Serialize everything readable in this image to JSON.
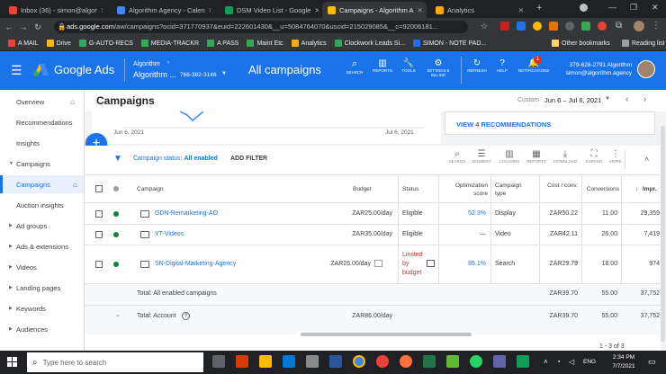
{
  "browser": {
    "tabs": [
      {
        "label": "Inbox (36) - simon@algor",
        "color": "#ea4335"
      },
      {
        "label": "Algorithm Agency - Calen",
        "color": "#4285f4"
      },
      {
        "label": "DSM Video List - Google",
        "color": "#0f9d58"
      },
      {
        "label": "Campaigns - Algorithm A",
        "color": "#fbbc04"
      },
      {
        "label": "Analytics",
        "color": "#f9ab00"
      }
    ],
    "new_tab": "+",
    "url_host": "ads.google.com",
    "url_rest": "/aw/campaigns?ocid=371770937&euid=222601430&__u=5084764070&uscid=215029085&__c=92006181...",
    "bookmarks": [
      "A MAIL",
      "Drive",
      "G-AUTO-RECS",
      "MEDIA-TRACKR",
      "A PASS",
      "Maint Etc",
      "Analytics",
      "Clockwork Leads Si...",
      "SIMON - NOTE PAD..."
    ],
    "other_bookmarks": "Other bookmarks",
    "reading_list": "Reading list"
  },
  "header": {
    "product": "Google Ads",
    "account_name_1": "Algorithm",
    "account_name_2": "Algorithm ...",
    "account_id": "766-382-3146",
    "page": "All campaigns",
    "tools": [
      "SEARCH",
      "REPORTS",
      "TOOLS",
      "SETTINGS & BILLING",
      "REFRESH",
      "HELP",
      "NOTIFICATIONS"
    ],
    "notif_count": "1",
    "user_id": "379-626-2791 Algorithm",
    "user_email": "simon@algorithm.agency"
  },
  "sidebar": {
    "items": [
      "Overview",
      "Recommendations",
      "Insights",
      "Campaigns",
      "Campaigns",
      "Auction insights",
      "Ad groups",
      "Ads & extensions",
      "Videos",
      "Landing pages",
      "Keywords",
      "Audiences"
    ]
  },
  "main": {
    "title": "Campaigns",
    "date_custom": "Custom",
    "date_range": "Jun 6 – Jul 6, 2021",
    "chart_start": "Jun 6, 2021",
    "chart_end": "Jul 6, 2021",
    "recommendations": "VIEW 4 RECOMMENDATIONS",
    "status_filter_label": "Campaign status:",
    "status_filter_value": "All enabled",
    "add_filter": "ADD FILTER",
    "toolbar": [
      "SEARCH",
      "SEGMENT",
      "COLUMNS",
      "REPORTS",
      "DOWNLOAD",
      "EXPAND",
      "MORE"
    ],
    "columns": [
      "Campaign",
      "Budget",
      "Status",
      "Optimization score",
      "Campaign type",
      "Cost / conv.",
      "Conversions",
      "Impr."
    ],
    "rows": [
      {
        "name": "GDN-Remarketing-AO",
        "budget": "ZAR25.00/day",
        "status": "Eligible",
        "opt": "52.3%",
        "type": "Display",
        "cost": "ZAR50.22",
        "conv": "11.00",
        "impr": "29,359"
      },
      {
        "name": "YT-Videos",
        "budget": "ZAR35.00/day",
        "status": "Eligible",
        "opt": "—",
        "type": "Video",
        "cost": "ZAR42.11",
        "conv": "26.00",
        "impr": "7,419"
      },
      {
        "name": "SN-Digital-Marketing-Agency",
        "budget": "ZAR26.00/day",
        "status": "Limited by budget",
        "opt": "85.1%",
        "type": "Search",
        "cost": "ZAR29.79",
        "conv": "18.00",
        "impr": "974"
      }
    ],
    "total_enabled": {
      "label": "Total: All enabled campaigns",
      "cost": "ZAR39.70",
      "conv": "55.00",
      "impr": "37,752"
    },
    "total_account": {
      "label": "Total: Account",
      "budget": "ZAR86.00/day",
      "cost": "ZAR39.70",
      "conv": "55.00",
      "impr": "37,752"
    },
    "pagination": "1 - 3 of 3"
  },
  "taskbar": {
    "search_placeholder": "Type here to search",
    "lang": "ENG",
    "time": "2:34 PM",
    "date": "7/7/2021"
  }
}
